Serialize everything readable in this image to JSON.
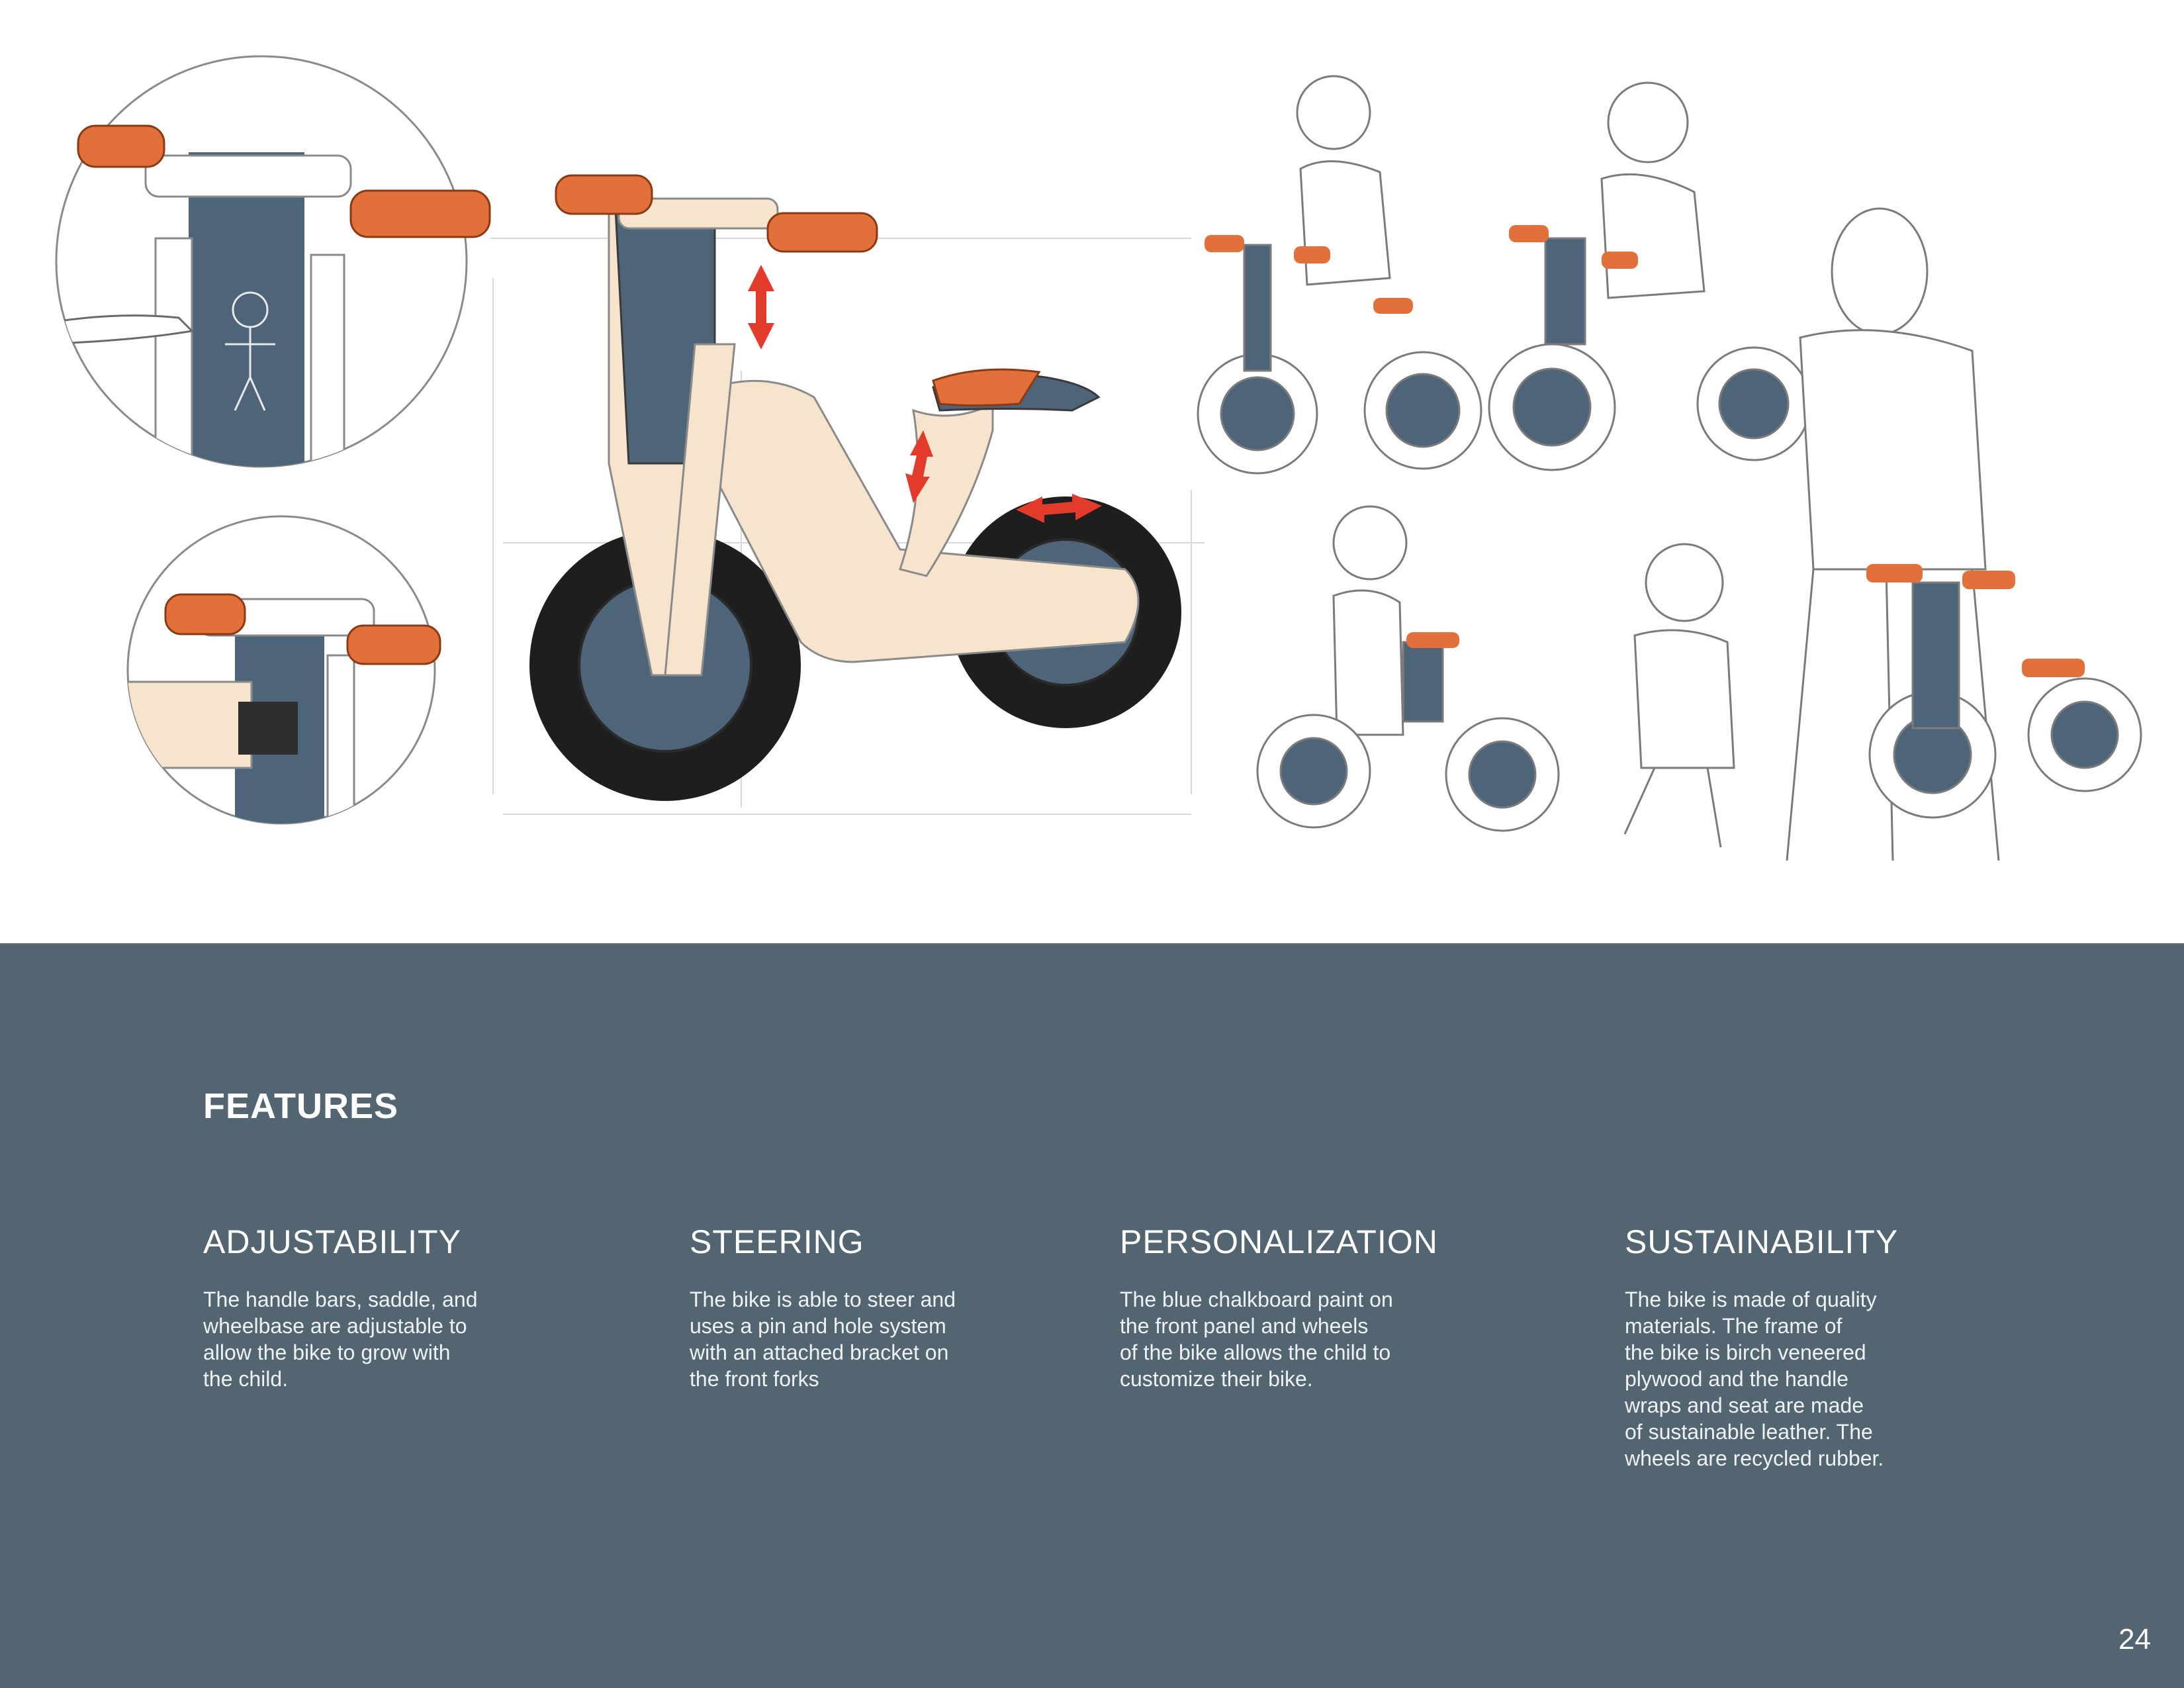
{
  "illustration": {
    "colors": {
      "orange": "#e2703a",
      "slate": "#4e6478",
      "wood": "#f6e4cc",
      "tire": "#1e1e1e",
      "arrow": "#e23b2b",
      "sketch": "#7b7b7b"
    }
  },
  "features": {
    "heading": "FEATURES",
    "items": [
      {
        "title": "ADJUSTABILITY",
        "lines": [
          "The handle bars, saddle, and",
          "wheelbase are adjustable to",
          "allow the bike to grow with",
          "the child."
        ]
      },
      {
        "title": "STEERING",
        "lines": [
          "The bike is able to steer and",
          "uses a pin and hole system",
          "with an attached bracket on",
          "the front forks"
        ]
      },
      {
        "title": "PERSONALIZATION",
        "lines": [
          "The blue chalkboard paint on",
          "the front panel and wheels",
          "of the bike allows the child to",
          "customize their bike."
        ]
      },
      {
        "title": "SUSTAINABILITY",
        "lines": [
          "The bike is made of quality",
          "materials. The frame of",
          "the bike is birch veneered",
          "plywood and the handle",
          "wraps and seat are made",
          "of sustainable leather. The",
          "wheels are recycled rubber."
        ]
      }
    ]
  },
  "page_number": "24"
}
